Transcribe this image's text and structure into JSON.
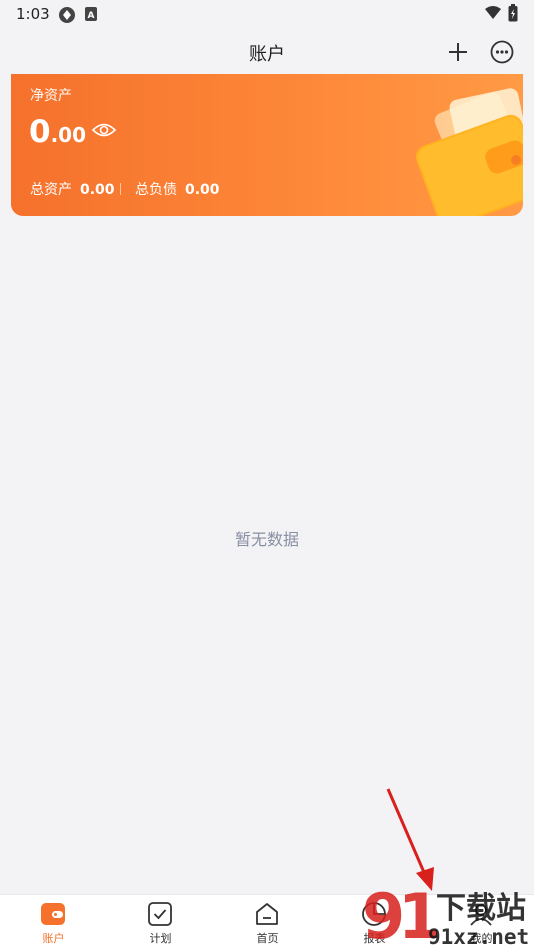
{
  "status_bar": {
    "time": "1:03"
  },
  "header": {
    "title": "账户"
  },
  "card": {
    "label": "净资产",
    "amount_int": "0",
    "amount_dec": ".00",
    "total_assets_label": "总资产",
    "total_assets_value": "0.00",
    "total_liabilities_label": "总负债",
    "total_liabilities_value": "0.00"
  },
  "empty_state": {
    "text": "暂无数据"
  },
  "bottom_nav": [
    {
      "label": "账户",
      "icon": "wallet-icon",
      "active": true
    },
    {
      "label": "计划",
      "icon": "checkbox-icon",
      "active": false
    },
    {
      "label": "首页",
      "icon": "home-icon",
      "active": false
    },
    {
      "label": "报表",
      "icon": "chart-icon",
      "active": false
    },
    {
      "label": "我的",
      "icon": "profile-icon",
      "active": false
    }
  ],
  "watermark": {
    "text_top": "下载站",
    "text_bottom": "91xz.net"
  },
  "colors": {
    "accent": "#f5712c",
    "background": "#f3f3f6",
    "muted": "#8a8fa3"
  }
}
